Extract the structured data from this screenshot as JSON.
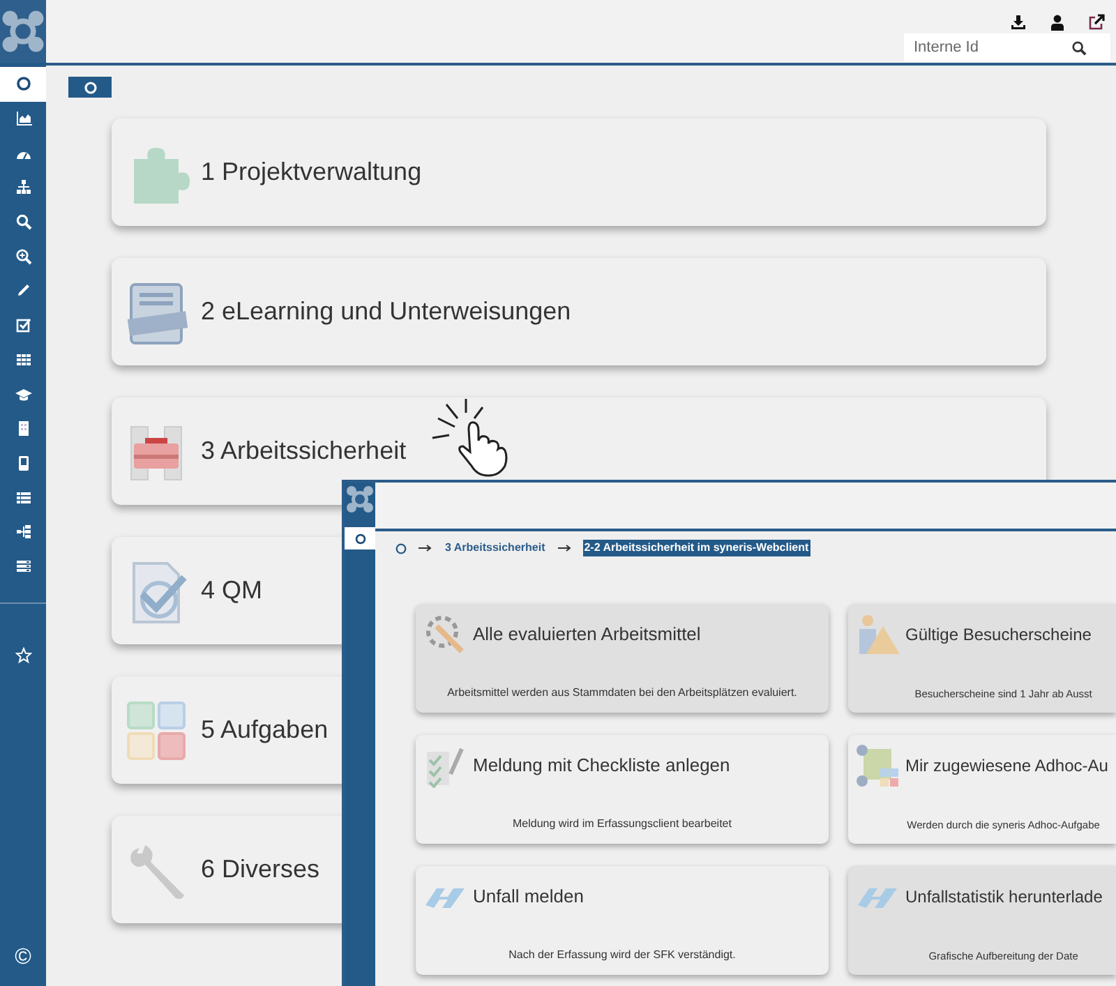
{
  "main": {
    "sidebar": {
      "items": [
        {
          "selected": true
        },
        {
          "selected": false
        },
        {
          "selected": false
        },
        {
          "selected": false
        },
        {
          "selected": false
        },
        {
          "selected": false
        },
        {
          "selected": false
        },
        {
          "selected": false
        },
        {
          "selected": false
        },
        {
          "selected": false
        },
        {
          "selected": false
        },
        {
          "selected": false
        },
        {
          "selected": false
        },
        {
          "selected": false
        },
        {
          "selected": false
        }
      ],
      "copyright": "©"
    },
    "search": {
      "placeholder": "Interne Id"
    },
    "home": {
      "selected": true
    },
    "tiles": [
      {
        "title": "1 Projektverwaltung"
      },
      {
        "title": "2 eLearning und Unterweisungen"
      },
      {
        "title": "3 Arbeitssicherheit"
      },
      {
        "title": "4 QM"
      },
      {
        "title": "5 Aufgaben"
      },
      {
        "title": "6 Diverses"
      }
    ]
  },
  "overlay": {
    "sidebar": {
      "items": [
        {
          "selected": true
        }
      ]
    },
    "breadcrumb": [
      {
        "label": "3 Arbeitssicherheit",
        "selected": false
      },
      {
        "label": "2-2 Arbeitssicherheit im syneris-Webclient",
        "selected": true
      }
    ],
    "tiles": [
      {
        "title": "Alle evaluierten Arbeitsmittel",
        "description": "Arbeitsmittel werden aus Stammdaten bei den Arbeitsplätzen evaluiert.",
        "highlighted": true
      },
      {
        "title": "Gültige Besucherscheine",
        "description": "Besucherscheine sind 1 Jahr ab Ausst",
        "highlighted": true
      },
      {
        "title": "Meldung mit Checkliste anlegen",
        "description": "Meldung wird im Erfassungsclient bearbeitet",
        "highlighted": false
      },
      {
        "title": "Mir zugewiesene Adhoc-Au",
        "description": "Werden durch die syneris Adhoc-Aufgabe",
        "highlighted": false
      },
      {
        "title": "Unfall melden",
        "description": "Nach der Erfassung wird der SFK verständigt.",
        "highlighted": false
      },
      {
        "title": "Unfallstatistik herunterlade",
        "description": "Grafische Aufbereitung der Date",
        "highlighted": true
      }
    ]
  }
}
